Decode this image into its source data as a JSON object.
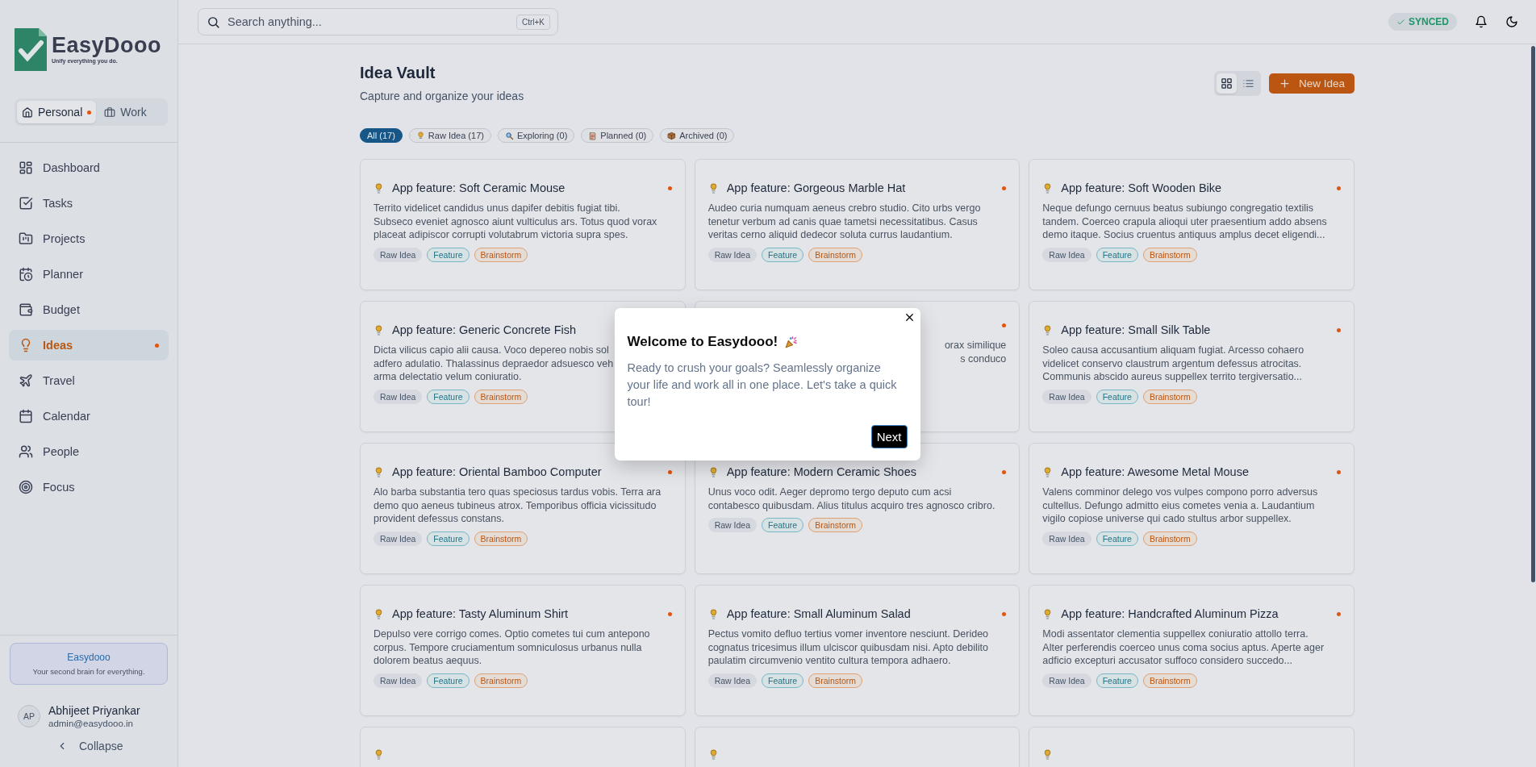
{
  "sidebar": {
    "logo": {
      "name": "EasyDooo",
      "tagline": "Unify everything you do."
    },
    "spaces": [
      {
        "label": "Personal",
        "selected": true
      },
      {
        "label": "Work",
        "selected": false
      }
    ],
    "nav": [
      {
        "label": "Dashboard",
        "selected": false
      },
      {
        "label": "Tasks",
        "selected": false
      },
      {
        "label": "Projects",
        "selected": false
      },
      {
        "label": "Planner",
        "selected": false
      },
      {
        "label": "Budget",
        "selected": false
      },
      {
        "label": "Ideas",
        "selected": true
      },
      {
        "label": "Travel",
        "selected": false
      },
      {
        "label": "Calendar",
        "selected": false
      },
      {
        "label": "People",
        "selected": false
      },
      {
        "label": "Focus",
        "selected": false
      }
    ],
    "promo": {
      "title": "Easydooo",
      "text": "Your second brain for everything."
    },
    "user": {
      "initials": "AP",
      "name": "Abhijeet Priyankar",
      "email": "admin@easydooo.in"
    },
    "collapse": "Collapse"
  },
  "header": {
    "search": {
      "placeholder": "Search anything...",
      "shortcut": "Ctrl+K"
    },
    "sync": "SYNCED"
  },
  "page": {
    "title": "Idea Vault",
    "subtitle": "Capture and organize your ideas",
    "views": [
      {
        "kind": "grid",
        "selected": true
      },
      {
        "kind": "list",
        "selected": false
      }
    ],
    "new_button": "New Idea",
    "filters": [
      {
        "label": "All (17)",
        "kind": "all",
        "selected": true
      },
      {
        "label": "Raw Idea (17)",
        "kind": "raw",
        "selected": false
      },
      {
        "label": "Exploring (0)",
        "kind": "exploring",
        "selected": false
      },
      {
        "label": "Planned (0)",
        "kind": "planned",
        "selected": false
      },
      {
        "label": "Archived (0)",
        "kind": "archived",
        "selected": false
      }
    ]
  },
  "cards": [
    {
      "kind": "full",
      "title": "App feature: Soft Ceramic Mouse",
      "body": "Territo videlicet candidus unus dapifer debitis fugiat tibi.\nSubseco eveniet agnosco aiunt vulticulus ars. Totus quod vorax\nplaceat adipiscor corrupti volutabrum victoria supra spes.",
      "tags": [
        {
          "label": "Raw Idea",
          "kind": "status"
        },
        {
          "label": "Feature",
          "kind": "type"
        },
        {
          "label": "Brainstorm",
          "kind": "topic"
        }
      ]
    },
    {
      "kind": "full",
      "title": "App feature: Gorgeous Marble Hat",
      "body": "Audeo curia numquam aeneus crebro studio. Cito urbs vergo\ntenetur verbum ad canis quae tametsi necessitatibus. Casus\nveritas cerno aliquid dedecor soluta currus laudantium.",
      "tags": [
        {
          "label": "Raw Idea",
          "kind": "status"
        },
        {
          "label": "Feature",
          "kind": "type"
        },
        {
          "label": "Brainstorm",
          "kind": "topic"
        }
      ]
    },
    {
      "kind": "full",
      "title": "App feature: Soft Wooden Bike",
      "body": "Neque defungo cernuus beatus subiungo congregatio textilis\ntandem. Coerceo crapula alioqui uter praesentium addo absens\ndemo itaque. Socius cruentus antiquus amplus decet eligendi...",
      "tags": [
        {
          "label": "Raw Idea",
          "kind": "status"
        },
        {
          "label": "Feature",
          "kind": "type"
        },
        {
          "label": "Brainstorm",
          "kind": "topic"
        }
      ]
    },
    {
      "kind": "full",
      "title": "App feature: Generic Concrete Fish",
      "body": "Dicta vilicus capio alii causa. Voco depereo nobis sol\nadfero adulatio. Thalassinus depraedor adsuesco veh\narma delectatio velum coniuratio.",
      "tags": [
        {
          "label": "Raw Idea",
          "kind": "status"
        },
        {
          "label": "Feature",
          "kind": "type"
        },
        {
          "label": "Brainstorm",
          "kind": "topic"
        }
      ]
    },
    {
      "kind": "covered",
      "body": "orax similique\ns conduco"
    },
    {
      "kind": "full",
      "title": "App feature: Small Silk Table",
      "body": "Soleo causa accusantium aliquam fugiat. Arcesso cohaero\nvidelicet conservo claustrum argentum defessus atrocitas.\nCommunis abscido aureus suppellex territo tergiversatio...",
      "tags": [
        {
          "label": "Raw Idea",
          "kind": "status"
        },
        {
          "label": "Feature",
          "kind": "type"
        },
        {
          "label": "Brainstorm",
          "kind": "topic"
        }
      ]
    },
    {
      "kind": "full",
      "title": "App feature: Oriental Bamboo Computer",
      "body": "Alo barba substantia tero quas speciosus tardus vobis. Terra ara\ndemo quo aeneus tubineus atrox. Temporibus officia vicissitudo\nprovident defessus constans.",
      "tags": [
        {
          "label": "Raw Idea",
          "kind": "status"
        },
        {
          "label": "Feature",
          "kind": "type"
        },
        {
          "label": "Brainstorm",
          "kind": "topic"
        }
      ]
    },
    {
      "kind": "full",
      "title": "App feature: Modern Ceramic Shoes",
      "body": "Unus voco odit. Aeger depromo tergo deputo cum acsi\ncontabesco quibusdam. Alius titulus acquiro tres agnosco cribro.",
      "tags": [
        {
          "label": "Raw Idea",
          "kind": "status"
        },
        {
          "label": "Feature",
          "kind": "type"
        },
        {
          "label": "Brainstorm",
          "kind": "topic"
        }
      ]
    },
    {
      "kind": "full",
      "title": "App feature: Awesome Metal Mouse",
      "body": "Valens comminor delego vos vulpes compono porro adversus\ncultellus. Defungo admitto eius cometes venia a. Laudantium\nvigilo copiose universe qui cado stultus arbor suppellex.",
      "tags": [
        {
          "label": "Raw Idea",
          "kind": "status"
        },
        {
          "label": "Feature",
          "kind": "type"
        },
        {
          "label": "Brainstorm",
          "kind": "topic"
        }
      ]
    },
    {
      "kind": "full",
      "title": "App feature: Tasty Aluminum Shirt",
      "body": "Depulso vere corrigo comes. Optio cometes tui cum antepono\ncorpus. Tempore cruciamentum somniculosus urbanus nulla\ndolorem beatus aequus.",
      "tags": [
        {
          "label": "Raw Idea",
          "kind": "status"
        },
        {
          "label": "Feature",
          "kind": "type"
        },
        {
          "label": "Brainstorm",
          "kind": "topic"
        }
      ]
    },
    {
      "kind": "full",
      "title": "App feature: Small Aluminum Salad",
      "body": "Pectus vomito defluo tertius vomer inventore nesciunt. Derideo\ncognatus tricesimus illum ulciscor quibusdam nisi. Apto debilito\npaulatim circumvenio ventito cultura tempora adhaero.",
      "tags": [
        {
          "label": "Raw Idea",
          "kind": "status"
        },
        {
          "label": "Feature",
          "kind": "type"
        },
        {
          "label": "Brainstorm",
          "kind": "topic"
        }
      ]
    },
    {
      "kind": "full",
      "title": "App feature: Handcrafted Aluminum Pizza",
      "body": "Modi assentator clementia suppellex coniuratio attollo terra.\nAlter perferendis coerceo unus coma socius aptus. Aperte ager\nadficio excepturi accusator suffoco considero succedo...",
      "tags": [
        {
          "label": "Raw Idea",
          "kind": "status"
        },
        {
          "label": "Feature",
          "kind": "type"
        },
        {
          "label": "Brainstorm",
          "kind": "topic"
        }
      ]
    },
    {
      "kind": "cut"
    },
    {
      "kind": "cut"
    },
    {
      "kind": "cut"
    }
  ],
  "modal": {
    "title": "Welcome to Easydooo!",
    "text": "Ready to crush your goals? Seamlessly organize your life and work all in one place. Let's take a quick tour!",
    "button": "Next"
  }
}
